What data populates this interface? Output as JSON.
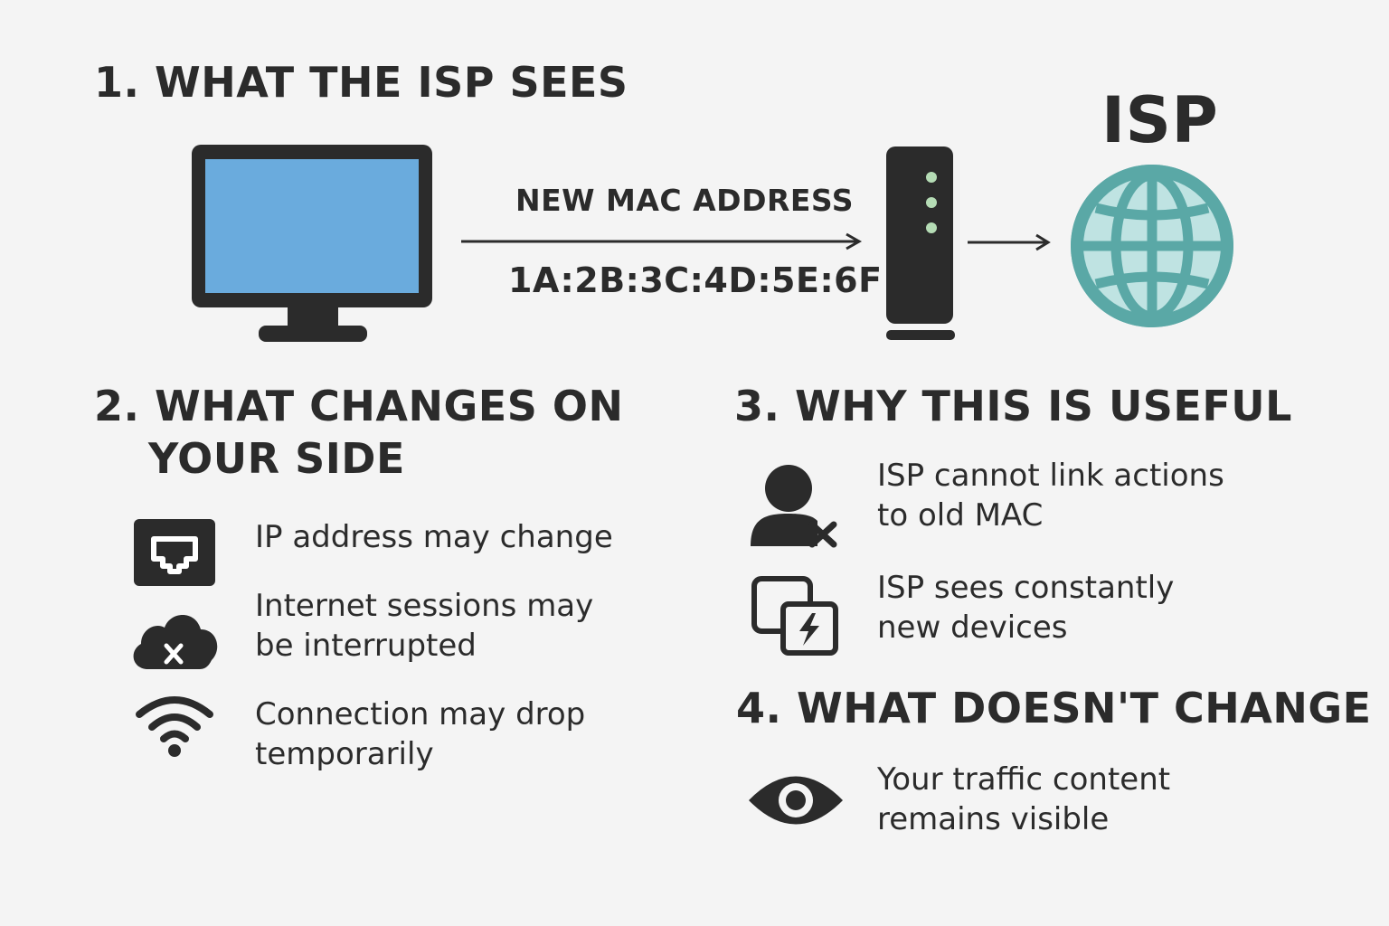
{
  "section1": {
    "title": "1. WHAT THE ISP SEES",
    "mac_label": "NEW MAC ADDRESS",
    "mac_value": "1A:2B:3C:4D:5E:6F",
    "isp_label": "ISP"
  },
  "section2": {
    "title_line1": "2. WHAT CHANGES ON",
    "title_line2": "YOUR SIDE",
    "items": [
      {
        "icon": "ethernet-port-icon",
        "lines": [
          "IP address may change"
        ]
      },
      {
        "icon": "cloud-error-icon",
        "lines": [
          "Internet sessions may",
          "be interrupted"
        ]
      },
      {
        "icon": "wifi-icon",
        "lines": [
          "Connection may drop",
          "temporarily"
        ]
      }
    ]
  },
  "section3": {
    "title": "3. WHY THIS IS USEFUL",
    "items": [
      {
        "icon": "user-blocked-icon",
        "lines": [
          "ISP cannot link actions",
          "to old MAC"
        ]
      },
      {
        "icon": "new-device-icon",
        "lines": [
          "ISP sees constantly",
          "new devices"
        ]
      }
    ]
  },
  "section4": {
    "title": "4. WHAT DOESN'T CHANGE",
    "items": [
      {
        "icon": "eye-icon",
        "lines": [
          "Your traffic content",
          "remains visible"
        ]
      }
    ]
  },
  "colors": {
    "screen": "#6aabdd",
    "dark": "#2b2b2b",
    "globe": "#5aa8a6",
    "globe_light": "#bfe3e2",
    "router_led": "#b5dcb5"
  }
}
